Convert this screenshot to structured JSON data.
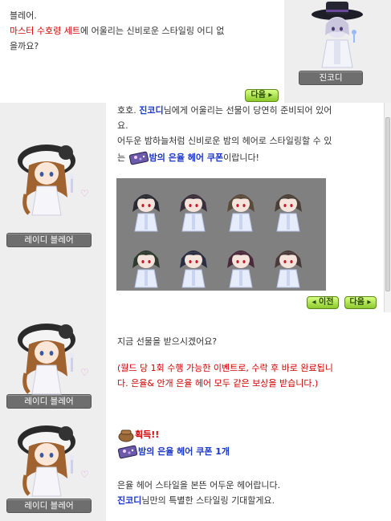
{
  "panel1": {
    "line1": "블레어.",
    "line2_red": "마스터 수호령 세트",
    "line2_rest": "에 어울리는 신비로운 스타일링 어디 없",
    "line3": "을까요?",
    "next_label": "다음",
    "npc_name": "진코디"
  },
  "panel2": {
    "l1_pre": "호호. ",
    "l1_name": "진코디",
    "l1_rest": "님에게 어울리는 선물이 당연히 준비되어 있어",
    "l2": "요.",
    "l3": "어두운 밤하늘처럼 신비로운 밤의 헤어로 스타일링할 수 있",
    "l4_pre": "는 ",
    "l4_item": "밤의 은율 헤어 쿠폰",
    "l4_rest": "이랍니다!",
    "npc_name": "레이디 블레어",
    "prev_label": "이전",
    "next_label": "다음"
  },
  "panel3": {
    "q": "지금 선물을 받으시겠어요?",
    "note1": "(월드 당 1회 수행 가능한 이벤트로, 수락 후 바로 완료됩니",
    "note2": "다. 은율& 안개 은율 헤어 모두 같은 보상을 받습니다.)",
    "npc_name": "레이디 블레어"
  },
  "panel4": {
    "acquire": "획득!!",
    "reward_item": "밤의 은율 헤어 쿠폰 1개",
    "d1": "은율 헤어 스타일을 본뜬 어두운 헤어랍니다.",
    "d2_name": "진코디",
    "d2_rest": "님만의 특별한 스타일링 기대할게요.",
    "npc_name": "레이디 블레어"
  },
  "colors": {
    "highlight_red": "#d00000",
    "highlight_blue": "#1a35c8",
    "button_green": "#8cc92c",
    "hair_colors": [
      "#2a2a33",
      "#3a2e3a",
      "#5a4a3a",
      "#4a4038",
      "#2e3a2e",
      "#2a2e40",
      "#4a2a3a",
      "#4a3a3a"
    ]
  },
  "icons": [
    "coupon-icon",
    "bag-icon",
    "heart-icon"
  ]
}
